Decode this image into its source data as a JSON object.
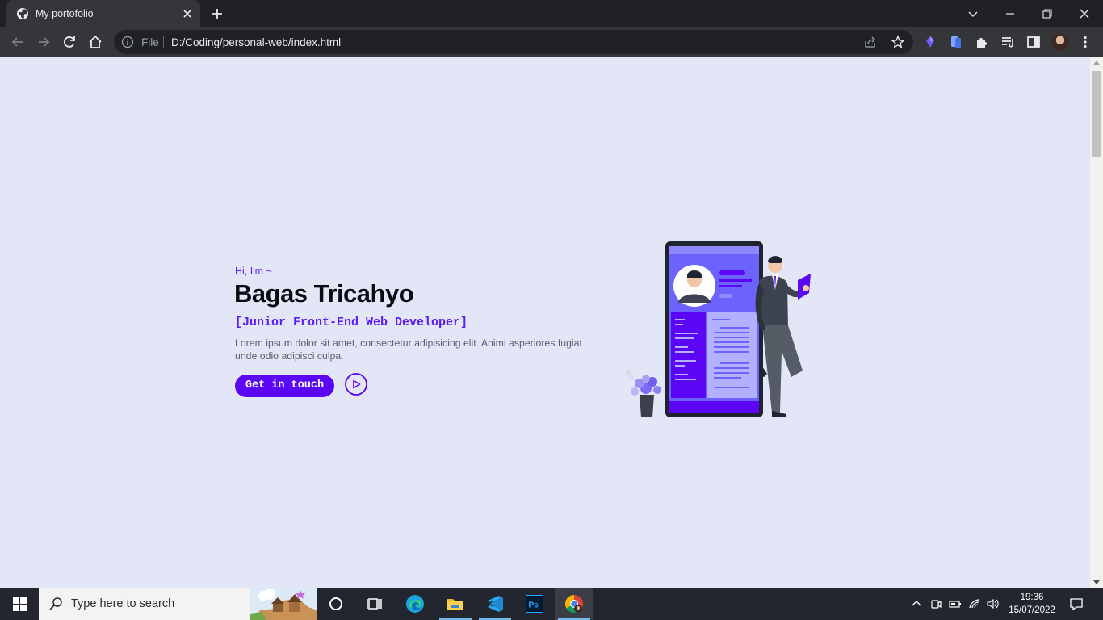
{
  "browser": {
    "tab_title": "My portofolio",
    "omnibox_scheme": "File",
    "omnibox_url": "D:/Coding/personal-web/index.html"
  },
  "hero": {
    "greeting": "Hi, I'm ~",
    "name": "Bagas Tricahyo",
    "role": "[Junior Front-End Web Developer]",
    "description": "Lorem ipsum dolor sit amet, consectetur adipisicing elit. Animi asperiores fugiat unde odio adipisci culpa.",
    "cta_label": "Get in touch"
  },
  "taskbar": {
    "search_placeholder": "Type here to search",
    "time": "19:36",
    "date": "15/07/2022"
  },
  "colors": {
    "accent": "#5b06f5",
    "page_bg": "#e3e6f6",
    "chrome_dark": "#202124",
    "chrome_toolbar": "#35363a",
    "taskbar": "#24262f"
  },
  "icons": {
    "favicon": "globe-icon",
    "back": "arrow-left-icon",
    "forward": "arrow-right-icon",
    "reload": "reload-icon",
    "home": "home-icon",
    "info": "info-icon",
    "share": "share-icon",
    "bookmark": "star-icon",
    "extensions": "puzzle-icon",
    "play": "play-circle-icon"
  }
}
